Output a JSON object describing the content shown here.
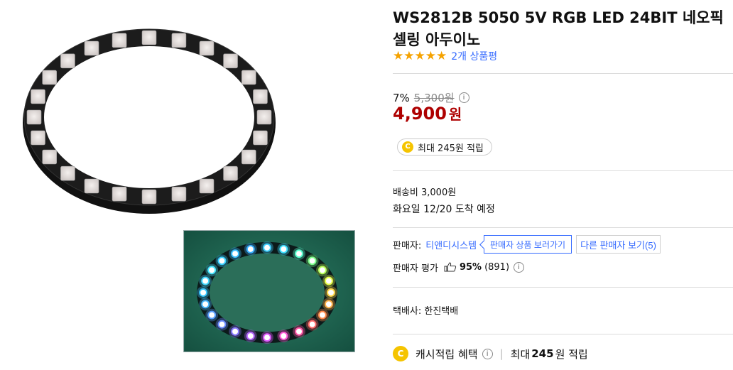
{
  "product": {
    "title": "WS2812B 5050 5V RGB LED 24BIT 네오픽셀링 아두이노",
    "rating_stars": 5,
    "review_link": "2개 상품평"
  },
  "price": {
    "discount_rate": "7%",
    "original_price": "5,300원",
    "sale_amount": "4,900",
    "sale_unit": "원",
    "info_glyph": "i"
  },
  "cash_badge": {
    "coin_glyph": "C",
    "label": "최대 245원 적립"
  },
  "shipping": {
    "fee": "배송비 3,000원",
    "arrival": "화요일 12/20 도착 예정"
  },
  "seller": {
    "label": "판매자:",
    "name": "티앤디시스템",
    "products_button": "판매자 상품 보러가기",
    "other_sellers_button": "다른 판매자 보기(5)",
    "rating_label": "판매자 평가",
    "rating_percent": "95%",
    "rating_count": "(891)"
  },
  "courier": "택배사: 한진택배",
  "cash_benefit": {
    "coin_glyph": "C",
    "label": "캐시적립 혜택",
    "separator": "|",
    "prefix": "최대",
    "amount": "245",
    "suffix": "원 적립"
  },
  "colors": {
    "accent_blue": "#346aff",
    "sale_red": "#ae0000",
    "star_orange": "#f5a200",
    "coin_yellow": "#f5c400"
  },
  "icons": [
    "star-icon",
    "info-icon",
    "coin-icon",
    "thumbs-up-icon"
  ]
}
